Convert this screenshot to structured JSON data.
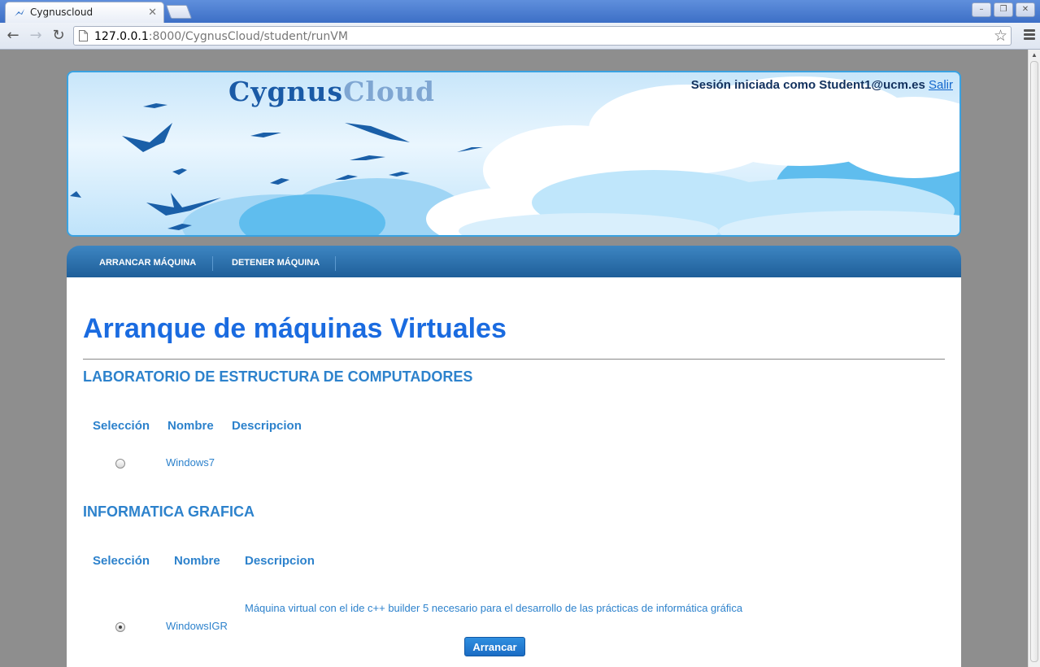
{
  "browser": {
    "tab_title": "Cygnuscloud",
    "tab_close": "✕",
    "url_host": "127.0.0.1",
    "url_rest": ":8000/CygnusCloud/student/runVM",
    "window_buttons": [
      "–",
      "❐",
      "✕"
    ]
  },
  "banner": {
    "logo_first": "Cygnus",
    "logo_second": "Cloud",
    "session_text": "Sesión iniciada como Student1@ucm.es",
    "logout_label": "Salir"
  },
  "nav": {
    "start_label": "ARRANCAR MÁQUINA",
    "stop_label": "DETENER MÁQUINA"
  },
  "page": {
    "title": "Arranque de máquinas Virtuales",
    "groups": [
      {
        "name": "LABORATORIO DE ESTRUCTURA DE COMPUTADORES",
        "headers": [
          "Selección",
          "Nombre",
          "Descripcion"
        ],
        "rows": [
          {
            "name": "Windows7",
            "description": "",
            "selected": false
          }
        ]
      },
      {
        "name": "INFORMATICA GRAFICA",
        "headers": [
          "Selección",
          "Nombre",
          "Descripcion"
        ],
        "rows": [
          {
            "name": "WindowsIGR",
            "description": "Máquina virtual con el ide c++ builder 5 necesario para el desarrollo de las prácticas de informática gráfica",
            "selected": true
          }
        ]
      }
    ],
    "submit_label": "Arrancar"
  },
  "colors": {
    "accent": "#1a6be0",
    "table_text": "#2d82cc",
    "nav_bar": "#1f5f99"
  }
}
